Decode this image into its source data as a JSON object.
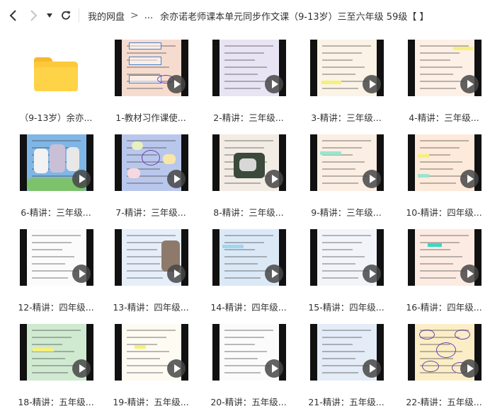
{
  "nav": {
    "back_icon": "chevron-left-icon",
    "forward_icon": "chevron-right-icon",
    "dropdown_icon": "caret-down-icon",
    "refresh_icon": "refresh-icon"
  },
  "breadcrumb": {
    "root": "我的网盘",
    "separator": ">",
    "ellipsis": "...",
    "current": "余亦诺老师课本单元同步作文课（9-13岁）三至六年级 59级【 】"
  },
  "colors": {
    "folder": "#fcc93a",
    "play_button": "#464646",
    "thumb_border": "#111111"
  },
  "files": [
    {
      "label": "（9-13岁）余亦...",
      "type": "folder"
    },
    {
      "label": "1-教材习作课使...",
      "type": "video",
      "bg": "#f6dccf"
    },
    {
      "label": "2-精讲：三年级...",
      "type": "video",
      "bg": "#e8e4f3"
    },
    {
      "label": "3-精讲：三年级...",
      "type": "video",
      "bg": "#fbf3e6"
    },
    {
      "label": "4-精讲：三年级...",
      "type": "video",
      "bg": "#fdf0e6"
    },
    {
      "label": "6-精讲：三年级...",
      "type": "video",
      "bg": "#7fb6e6"
    },
    {
      "label": "7-精讲：三年级...",
      "type": "video",
      "bg": "#b9c7ec"
    },
    {
      "label": "8-精讲：三年级...",
      "type": "video",
      "bg": "#f3ece4"
    },
    {
      "label": "9-精讲：三年级...",
      "type": "video",
      "bg": "#fbeee3"
    },
    {
      "label": "10-精讲：四年级...",
      "type": "video",
      "bg": "#fdeadb"
    },
    {
      "label": "12-精讲：四年级...",
      "type": "video",
      "bg": "#fbfbfb"
    },
    {
      "label": "13-精讲：四年级...",
      "type": "video",
      "bg": "#e6eefa"
    },
    {
      "label": "14-精讲：四年级...",
      "type": "video",
      "bg": "#dbe9f7"
    },
    {
      "label": "15-精讲：四年级...",
      "type": "video",
      "bg": "#f2f4fa"
    },
    {
      "label": "16-精讲：四年级...",
      "type": "video",
      "bg": "#fcebe2"
    },
    {
      "label": "18-精讲：五年级...",
      "type": "video",
      "bg": "#cfead0"
    },
    {
      "label": "19-精讲：五年级...",
      "type": "video",
      "bg": "#fdfbf2"
    },
    {
      "label": "20-精讲：五年级...",
      "type": "video",
      "bg": "#fbfbfb"
    },
    {
      "label": "21-精讲：五年级...",
      "type": "video",
      "bg": "#e4ecf7"
    },
    {
      "label": "22-精讲：五年级...",
      "type": "video",
      "bg": "#fbeec7"
    }
  ]
}
